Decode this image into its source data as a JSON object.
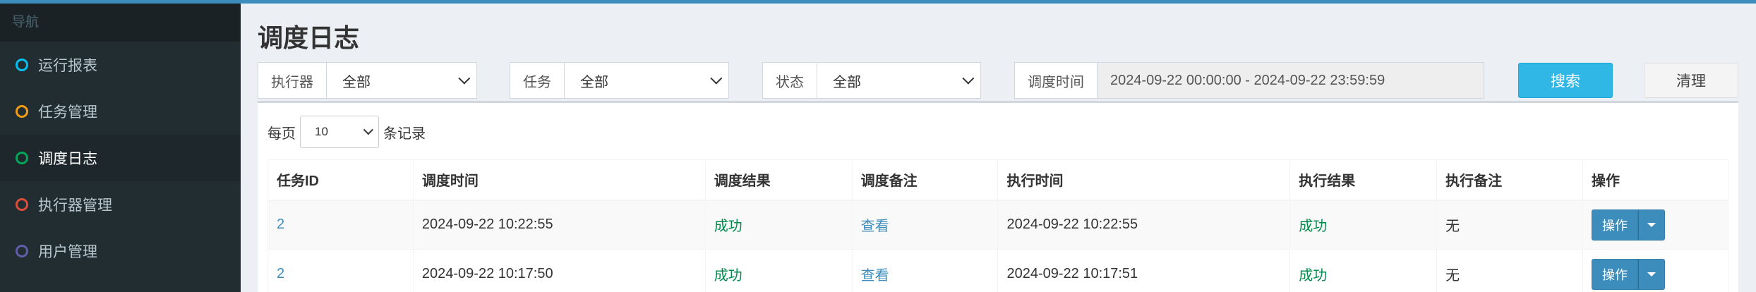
{
  "sidebar": {
    "header": "导航",
    "items": [
      {
        "label": "运行报表",
        "color": "#00c0ef"
      },
      {
        "label": "任务管理",
        "color": "#f39c12"
      },
      {
        "label": "调度日志",
        "color": "#00a65a",
        "active": true
      },
      {
        "label": "执行器管理",
        "color": "#dd4b39"
      },
      {
        "label": "用户管理",
        "color": "#605ca8"
      }
    ]
  },
  "page": {
    "title": "调度日志"
  },
  "filters": {
    "executor_label": "执行器",
    "executor_value": "全部",
    "task_label": "任务",
    "task_value": "全部",
    "status_label": "状态",
    "status_value": "全部",
    "time_label": "调度时间",
    "time_value": "2024-09-22 00:00:00 - 2024-09-22 23:59:59",
    "search_label": "搜索",
    "clear_label": "清理"
  },
  "length": {
    "prefix": "每页",
    "value": "10",
    "suffix": "条记录"
  },
  "table": {
    "headers": [
      "任务ID",
      "调度时间",
      "调度结果",
      "调度备注",
      "执行时间",
      "执行结果",
      "执行备注",
      "操作"
    ],
    "rows": [
      {
        "id": "2",
        "trigger_time": "2024-09-22 10:22:55",
        "trigger_result": "成功",
        "trigger_note": "查看",
        "handle_time": "2024-09-22 10:22:55",
        "handle_result": "成功",
        "handle_note": "无",
        "action": "操作"
      },
      {
        "id": "2",
        "trigger_time": "2024-09-22 10:17:50",
        "trigger_result": "成功",
        "trigger_note": "查看",
        "handle_time": "2024-09-22 10:17:51",
        "handle_result": "成功",
        "handle_note": "无",
        "action": "操作"
      }
    ]
  },
  "colors": {
    "accent": "#3c8dbc",
    "success": "#008d4c",
    "search_button": "#31b7e6"
  }
}
